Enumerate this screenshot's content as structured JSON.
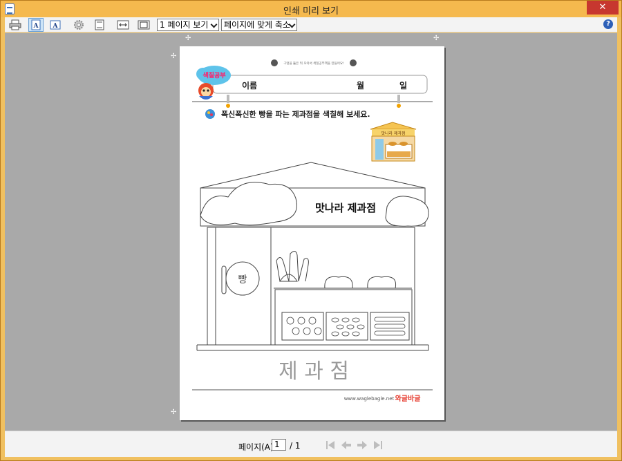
{
  "window": {
    "title": "인쇄 미리 보기",
    "close_label": "✕"
  },
  "toolbar": {
    "page_view_select": "1 페이지 보기",
    "zoom_select": "페이지에 맞게 축소",
    "help_label": "?"
  },
  "document": {
    "notice": "구멍을 뚫은 뒤 모아서 색칠공부책을 만들어요!",
    "logo_text": "색칠공부",
    "name_label": "이름",
    "month_label": "월",
    "day_label": "일",
    "instruction": "폭신폭신한 빵을 파는 제과점을 색칠해 보세요.",
    "thumb_sign": "맛나라 제과점",
    "shop_sign": "맛나라 제과점",
    "door_sign": "빵",
    "caption": "제 과 점",
    "website": "www.waglebagle.net",
    "brand": "와글바글"
  },
  "status": {
    "page_label": "페이지(A)",
    "page_value": "1",
    "page_total": "/ 1"
  },
  "colors": {
    "titlebar": "#f5b94e",
    "viewport": "#a9a9a9",
    "accent": "#2c5fb8"
  }
}
